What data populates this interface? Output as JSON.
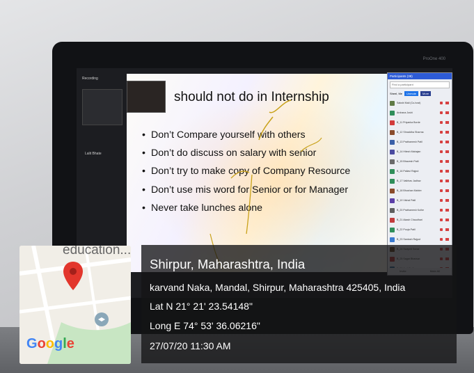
{
  "meeting": {
    "left_label": "Recording",
    "left_name": "Lalit Bhate",
    "monitor_brand": "ProOne 400"
  },
  "slide": {
    "title": "should not do in Internship",
    "bullets": [
      "Don’t Compare yourself with others",
      "Don’t do discuss on salary with senior",
      "Don’t try to make copy of Company Resource",
      "Don’t use mis word for Senior or for Manager",
      "Never take lunches alone"
    ]
  },
  "participants": {
    "header": "Participants (38)",
    "search_placeholder": "Find a participant",
    "host_label": "Sheel, Me",
    "unmute": "Unmute",
    "more": "More",
    "footer_left": "Invite",
    "footer_right": "Mute All",
    "rows": [
      {
        "name": "Sakshi Mali (Co-host)",
        "color": "#5f7a45"
      },
      {
        "name": "Archana Joshi",
        "color": "#2f8e5a"
      },
      {
        "name": "B_11 Priyanka Borde",
        "color": "#d23b3b"
      },
      {
        "name": "B_12 Shraddha Sharma",
        "color": "#8a4a2a"
      },
      {
        "name": "B_13 Prathamesh Patil",
        "color": "#3a5fa8"
      },
      {
        "name": "B_14 Hitesh Mahajan",
        "color": "#4a4aa0"
      },
      {
        "name": "B_15 Bhavesh Patil",
        "color": "#6a6a6a"
      },
      {
        "name": "B_16 Pallavi Rajput",
        "color": "#2f8e5a"
      },
      {
        "name": "B_17 Vaibhav Jadhav",
        "color": "#2f8e5a"
      },
      {
        "name": "B_18 Bhushan Mahire",
        "color": "#8a4a2a"
      },
      {
        "name": "B_19 Vishal Patil",
        "color": "#5b3fa8"
      },
      {
        "name": "B_20 Prathamesh Kolhe",
        "color": "#5f5f5f"
      },
      {
        "name": "B_21 Akash Chaudhari",
        "color": "#c23c3c"
      },
      {
        "name": "B_22 Pooja Patil",
        "color": "#2f8e5a"
      },
      {
        "name": "B_23 Santosh Rajput",
        "color": "#3a7ad0"
      },
      {
        "name": "B_24 Swapnil Sonar",
        "color": "#6b4a2a"
      },
      {
        "name": "B_25 Sagar Bhavsar",
        "color": "#c23c3c"
      },
      {
        "name": "B_26 Amit Patil",
        "color": "#2f6e9a"
      }
    ]
  },
  "map": {
    "place_label": "education...",
    "brand": "Google"
  },
  "location": {
    "city": "Shirpur, Maharashtra, India",
    "address": "karvand Naka, Mandal, Shirpur, Maharashtra 425405, India",
    "lat": "Lat N 21° 21' 23.54148\"",
    "long": "Long E 74° 53' 36.06216\"",
    "datetime": "27/07/20 11:30 AM"
  },
  "colors": {
    "google_blue": "#4285f4",
    "google_red": "#ea4335",
    "google_yellow": "#fbbc05",
    "google_green": "#34a853",
    "pin_red": "#e2362c"
  }
}
